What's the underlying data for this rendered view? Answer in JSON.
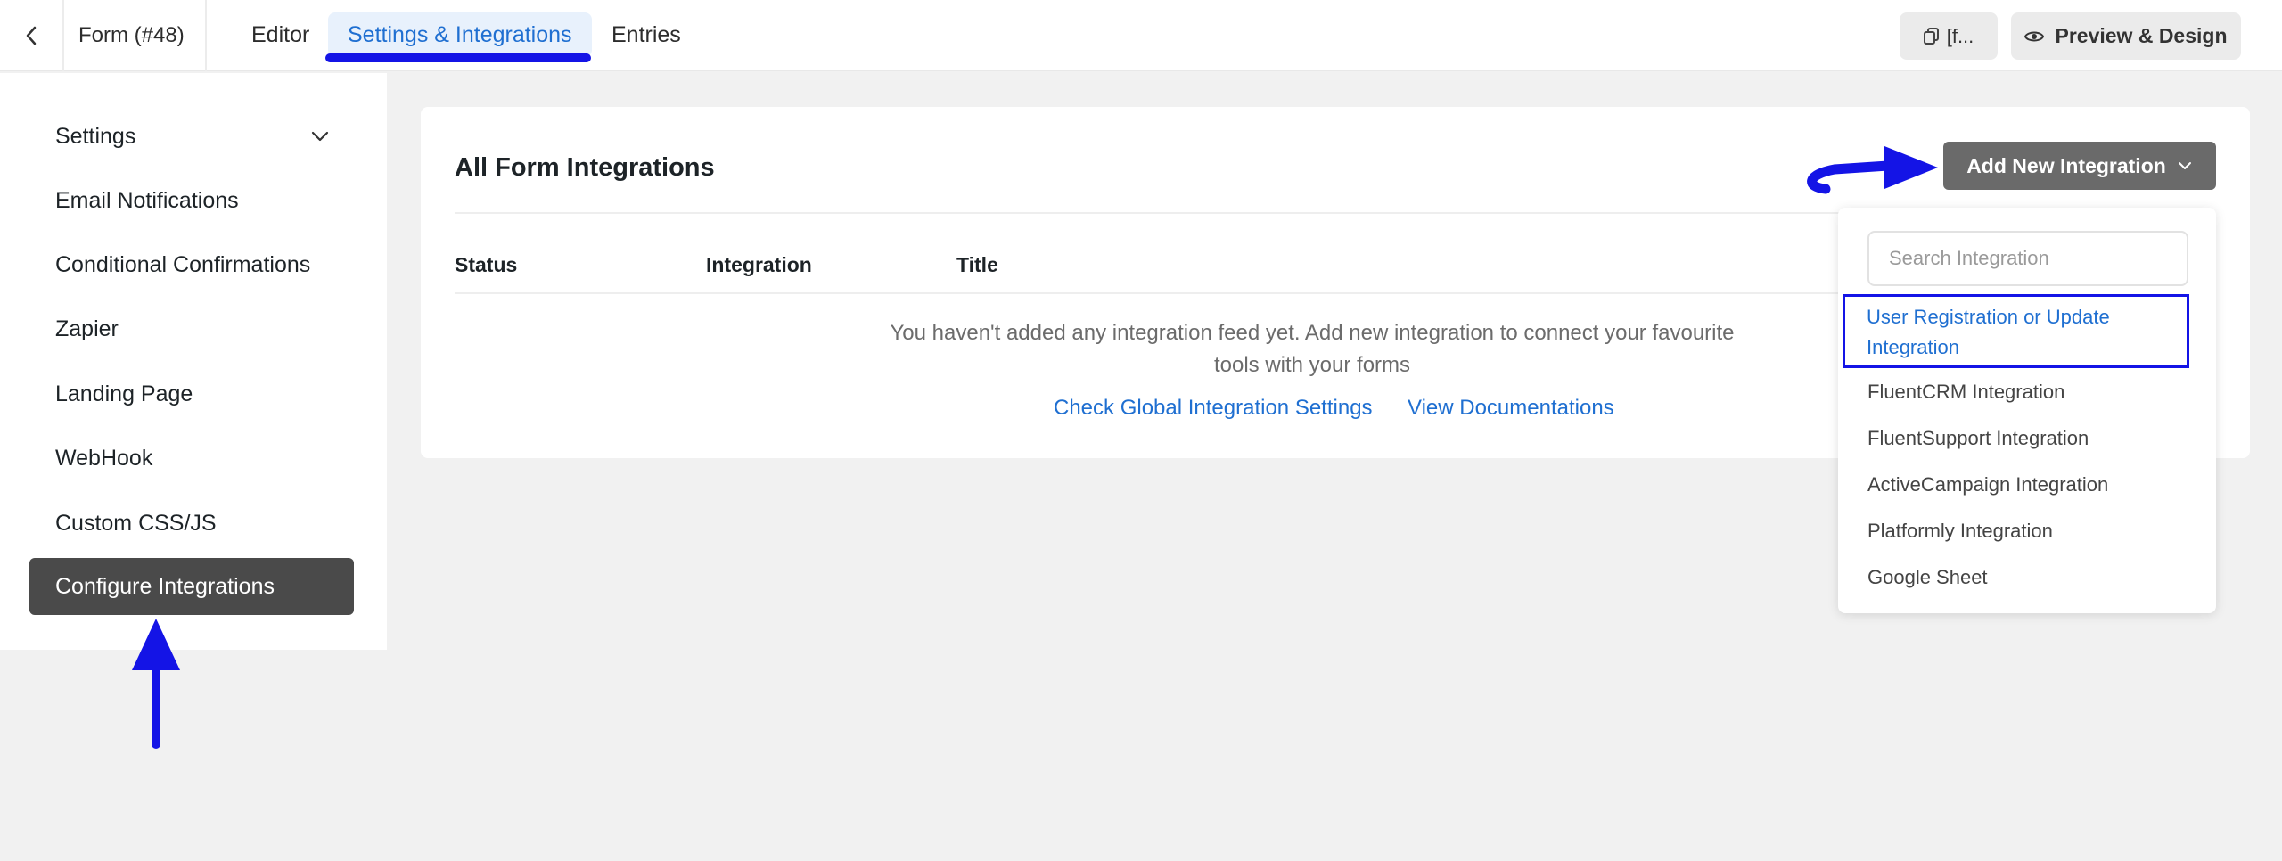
{
  "header": {
    "form_title": "Form (#48)",
    "tabs": [
      {
        "label": "Editor"
      },
      {
        "label": "Settings & Integrations",
        "active": true
      },
      {
        "label": "Entries"
      }
    ],
    "shortcode_label": "[f...",
    "preview_label": "Preview & Design"
  },
  "sidebar": {
    "items": [
      {
        "label": "Settings"
      },
      {
        "label": "Email Notifications"
      },
      {
        "label": "Conditional Confirmations"
      },
      {
        "label": "Zapier"
      },
      {
        "label": "Landing Page"
      },
      {
        "label": "WebHook"
      },
      {
        "label": "Custom CSS/JS"
      },
      {
        "label": "Configure Integrations",
        "active": true
      }
    ]
  },
  "main": {
    "title": "All Form Integrations",
    "add_button_label": "Add New Integration",
    "columns": [
      "Status",
      "Integration",
      "Title"
    ],
    "empty_message": "You haven't added any integration feed yet. Add new integration to connect your favourite tools with your forms",
    "links": [
      "Check Global Integration Settings",
      "View Documentations"
    ]
  },
  "dropdown": {
    "search_placeholder": "Search Integration",
    "items": [
      {
        "label": "User Registration or Update Integration"
      },
      {
        "label": "FluentCRM Integration"
      },
      {
        "label": "FluentSupport Integration"
      },
      {
        "label": "ActiveCampaign Integration"
      },
      {
        "label": "Platformly Integration"
      },
      {
        "label": "Google Sheet"
      }
    ]
  },
  "colors": {
    "accent": "#1f6fd1",
    "annotation": "#1414e6",
    "active_sidebar": "#4a4a4a",
    "add_button": "#6a6a6a"
  }
}
